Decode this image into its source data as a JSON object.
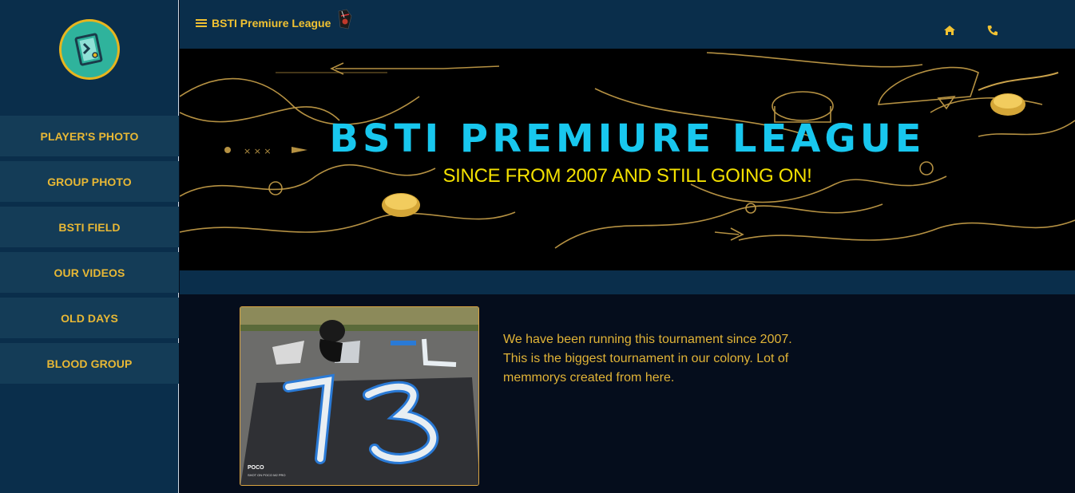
{
  "brand": {
    "title": "BSTI Premiure League"
  },
  "sidebar": {
    "items": [
      {
        "label": "PLAYER'S PHOTO"
      },
      {
        "label": "GROUP PHOTO"
      },
      {
        "label": "BSTI FIELD"
      },
      {
        "label": "OUR VIDEOS"
      },
      {
        "label": "OLD DAYS"
      },
      {
        "label": "BLOOD GROUP"
      }
    ]
  },
  "topbar": {
    "icons": [
      "home-icon",
      "phone-icon"
    ]
  },
  "hero": {
    "title": "BSTI PREMIURE LEAGUE",
    "subtitle": "SINCE FROM 2007 AND STILL GOING ON!"
  },
  "content": {
    "photo_caption": "POCO",
    "photo_subcaption": "SHOT ON POCO M2 PRO",
    "description": "We have been running this tournament since 2007.\nThis is the biggest tournament in our colony. Lot of\nmemmorys created from here."
  },
  "colors": {
    "sidebar_bg": "#0a2e4b",
    "accent_gold": "#e8b835",
    "hero_title": "#18c7ee",
    "hero_sub": "#f4e100",
    "page_bg": "#050d1c"
  }
}
